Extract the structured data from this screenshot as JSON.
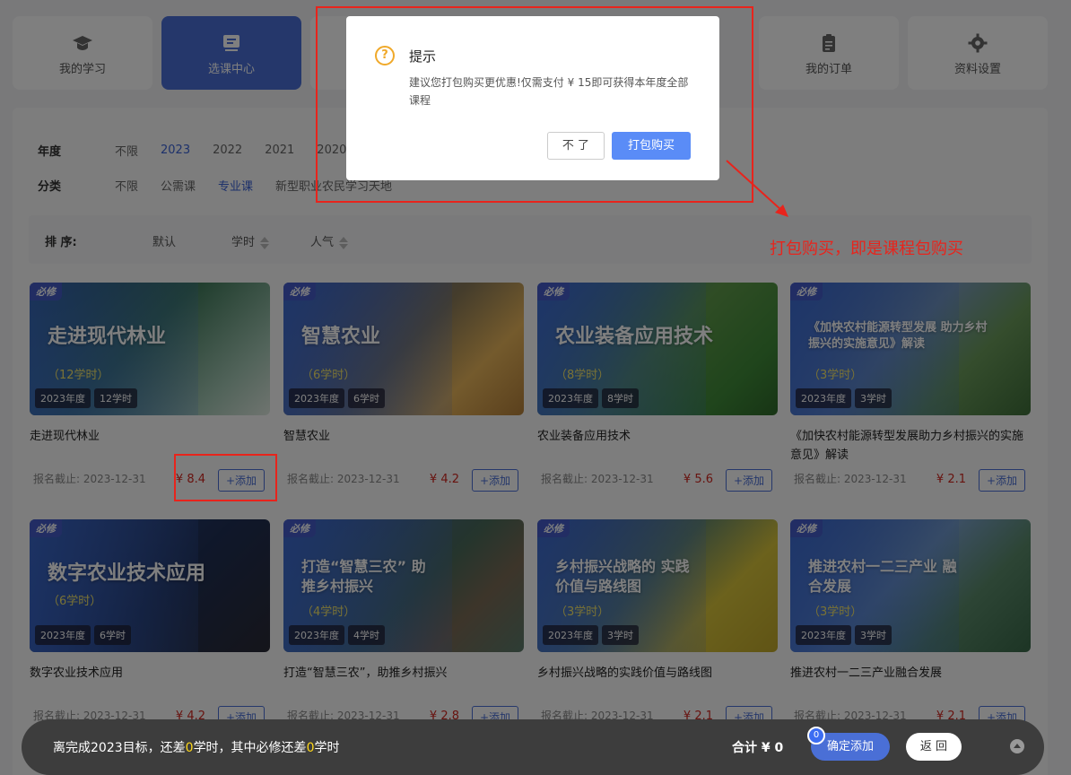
{
  "nav": [
    {
      "label": "我的学习",
      "icon": "graduation-cap-icon"
    },
    {
      "label": "选课中心",
      "icon": "course-list-icon"
    },
    {
      "label": "我的订单",
      "icon": "order-clipboard-icon"
    },
    {
      "label": "资料设置",
      "icon": "gear-icon"
    }
  ],
  "filters": {
    "year": {
      "label": "年度",
      "options": [
        "不限",
        "2023",
        "2022",
        "2021",
        "2020"
      ],
      "selected": "2023"
    },
    "category": {
      "label": "分类",
      "options": [
        "不限",
        "公需课",
        "专业课",
        "新型职业农民学习天地"
      ],
      "selected": "专业课"
    }
  },
  "sort": {
    "label": "排 序:",
    "default": "默认",
    "hours": "学时",
    "popularity": "人气"
  },
  "courses": [
    {
      "badge": "必修",
      "banner": "走进现代林业",
      "banner_hours": "（12学时）",
      "year_tag": "2023年度",
      "hours_tag": "12学时",
      "title": "走进现代林业",
      "deadline": "报名截止:  2023-12-31",
      "price": "¥ 8.4",
      "add": "+添加"
    },
    {
      "badge": "必修",
      "banner": "智慧农业",
      "banner_hours": "（6学时）",
      "year_tag": "2023年度",
      "hours_tag": "6学时",
      "title": "智慧农业",
      "deadline": "报名截止:  2023-12-31",
      "price": "¥ 4.2",
      "add": "+添加"
    },
    {
      "badge": "必修",
      "banner": "农业装备应用技术",
      "banner_hours": "（8学时）",
      "year_tag": "2023年度",
      "hours_tag": "8学时",
      "title": "农业装备应用技术",
      "deadline": "报名截止:  2023-12-31",
      "price": "¥ 5.6",
      "add": "+添加"
    },
    {
      "badge": "必修",
      "banner": "《加快农村能源转型发展 助力乡村振兴的实施意见》解读",
      "banner_hours": "（3学时）",
      "year_tag": "2023年度",
      "hours_tag": "3学时",
      "title": "《加快农村能源转型发展助力乡村振兴的实施意见》解读",
      "deadline": "报名截止:  2023-12-31",
      "price": "¥ 2.1",
      "add": "+添加"
    },
    {
      "badge": "必修",
      "banner": "数字农业技术应用",
      "banner_hours": "（6学时）",
      "year_tag": "2023年度",
      "hours_tag": "6学时",
      "title": "数字农业技术应用",
      "deadline": "报名截止:  2023-12-31",
      "price": "¥ 4.2",
      "add": "+添加"
    },
    {
      "badge": "必修",
      "banner": "打造“智慧三农” 助推乡村振兴",
      "banner_hours": "（4学时）",
      "year_tag": "2023年度",
      "hours_tag": "4学时",
      "title": "打造“智慧三农”，助推乡村振兴",
      "deadline": "报名截止:  2023-12-31",
      "price": "¥ 2.8",
      "add": "+添加"
    },
    {
      "badge": "必修",
      "banner": "乡村振兴战略的 实践价值与路线图",
      "banner_hours": "（3学时）",
      "year_tag": "2023年度",
      "hours_tag": "3学时",
      "title": "乡村振兴战略的实践价值与路线图",
      "deadline": "报名截止:  2023-12-31",
      "price": "¥ 2.1",
      "add": "+添加"
    },
    {
      "badge": "必修",
      "banner": "推进农村一二三产业 融合发展",
      "banner_hours": "（3学时）",
      "year_tag": "2023年度",
      "hours_tag": "3学时",
      "title": "推进农村一二三产业融合发展",
      "deadline": "报名截止:  2023-12-31",
      "price": "¥ 2.1",
      "add": "+添加"
    }
  ],
  "dialog": {
    "title": "提示",
    "icon": "question-circle-icon",
    "message": "建议您打包购买更优惠!仅需支付 ¥ 15即可获得本年度全部课程",
    "cancel": "不 了",
    "confirm": "打包购买"
  },
  "annotation": {
    "text": "打包购买，即是课程包购买",
    "color": "#e8241c"
  },
  "bottom_bar": {
    "goal_prefix": "离完成2023目标，还差",
    "hours_short": "0",
    "goal_mid": "学时，其中必修还差",
    "required_short": "0",
    "goal_suffix": "学时",
    "total": "合计 ¥ 0",
    "cart_count": "0",
    "confirm": "确定添加",
    "back": "返 回"
  },
  "colors": {
    "accent": "#4a6fd6",
    "price": "#d0261f",
    "highlight": "#ffd81a"
  }
}
